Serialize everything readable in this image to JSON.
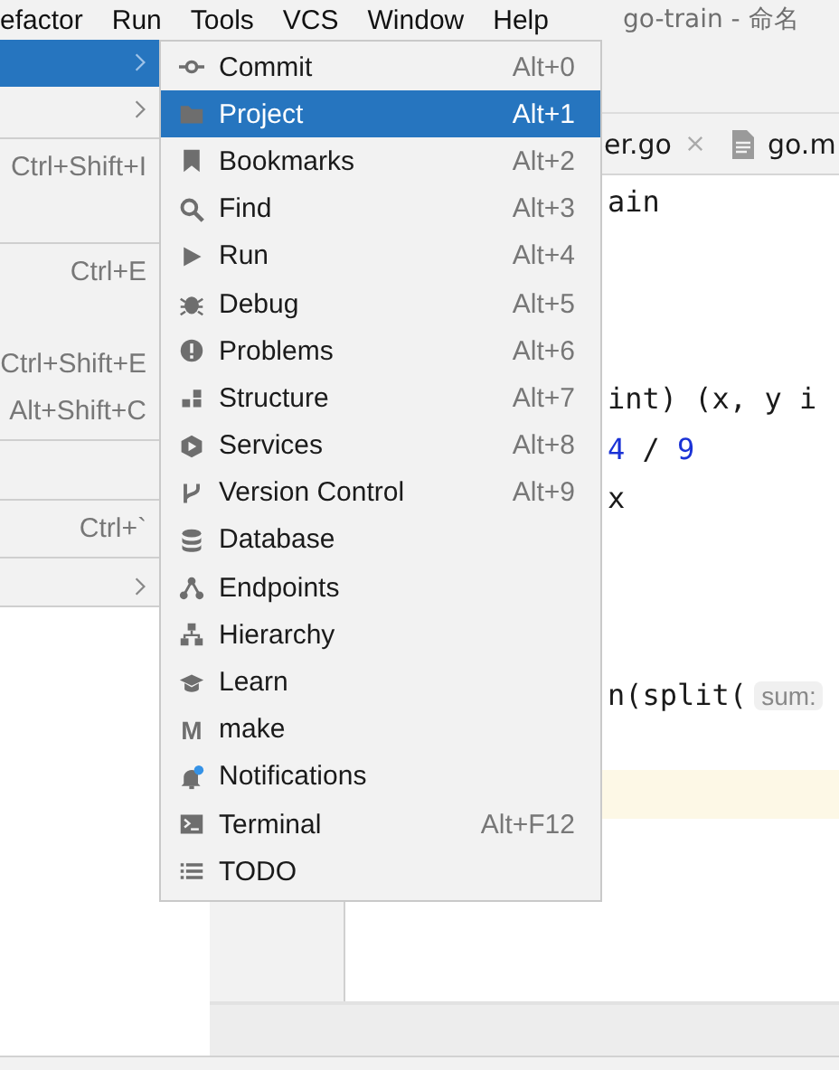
{
  "menubar": {
    "items": [
      {
        "label": "efactor"
      },
      {
        "label": "Run"
      },
      {
        "label": "Tools"
      },
      {
        "label": "VCS"
      },
      {
        "label": "Window"
      },
      {
        "label": "Help"
      }
    ],
    "title": "go-train - 命名"
  },
  "parent_menu": {
    "rows": [
      {
        "kind": "item",
        "submenu": true,
        "selected": true
      },
      {
        "kind": "item",
        "submenu": true,
        "selected": false
      },
      {
        "kind": "separator"
      },
      {
        "kind": "item",
        "shortcut": "Ctrl+Shift+I",
        "selected": false
      },
      {
        "kind": "blank"
      },
      {
        "kind": "separator"
      },
      {
        "kind": "item",
        "shortcut": "Ctrl+E",
        "selected": false
      },
      {
        "kind": "blank"
      },
      {
        "kind": "item",
        "shortcut": "Ctrl+Shift+E",
        "selected": false
      },
      {
        "kind": "item",
        "shortcut": "Alt+Shift+C",
        "selected": false
      },
      {
        "kind": "separator"
      },
      {
        "kind": "blank"
      },
      {
        "kind": "separator"
      },
      {
        "kind": "item",
        "shortcut": "Ctrl+`",
        "selected": false
      },
      {
        "kind": "separator"
      },
      {
        "kind": "item",
        "submenu": true,
        "selected": false
      }
    ]
  },
  "tools_menu": {
    "items": [
      {
        "label": "Commit",
        "shortcut": "Alt+0",
        "selected": false
      },
      {
        "label": "Project",
        "shortcut": "Alt+1",
        "selected": true
      },
      {
        "label": "Bookmarks",
        "shortcut": "Alt+2",
        "selected": false
      },
      {
        "label": "Find",
        "shortcut": "Alt+3",
        "selected": false
      },
      {
        "label": "Run",
        "shortcut": "Alt+4",
        "selected": false
      },
      {
        "label": "Debug",
        "shortcut": "Alt+5",
        "selected": false
      },
      {
        "label": "Problems",
        "shortcut": "Alt+6",
        "selected": false
      },
      {
        "label": "Structure",
        "shortcut": "Alt+7",
        "selected": false
      },
      {
        "label": "Services",
        "shortcut": "Alt+8",
        "selected": false
      },
      {
        "label": "Version Control",
        "shortcut": "Alt+9",
        "selected": false
      },
      {
        "label": "Database",
        "selected": false
      },
      {
        "label": "Endpoints",
        "selected": false
      },
      {
        "label": "Hierarchy",
        "selected": false
      },
      {
        "label": "Learn",
        "selected": false
      },
      {
        "label": "make",
        "glyph": "M",
        "selected": false
      },
      {
        "label": "Notifications",
        "selected": false
      },
      {
        "label": "Terminal",
        "shortcut": "Alt+F12",
        "selected": false
      },
      {
        "label": "TODO",
        "selected": false
      }
    ]
  },
  "tabs": [
    {
      "label": "er.go",
      "closable": true
    },
    {
      "label": "go.m"
    }
  ],
  "editor": {
    "current_line_highlight": true,
    "lines": [
      {
        "segments": [
          {
            "text": "ain",
            "kind": "plain"
          }
        ]
      },
      {
        "segments": [
          {
            "text": "int) (x, y i",
            "kind": "plain"
          }
        ]
      },
      {
        "segments": [
          {
            "text": "4",
            "kind": "number"
          },
          {
            "text": " / ",
            "kind": "plain"
          },
          {
            "text": "9",
            "kind": "number"
          }
        ]
      },
      {
        "segments": [
          {
            "text": "x",
            "kind": "plain"
          }
        ]
      },
      {
        "segments": [
          {
            "text": "n(split(",
            "kind": "plain"
          }
        ],
        "hint": "sum:"
      }
    ]
  }
}
